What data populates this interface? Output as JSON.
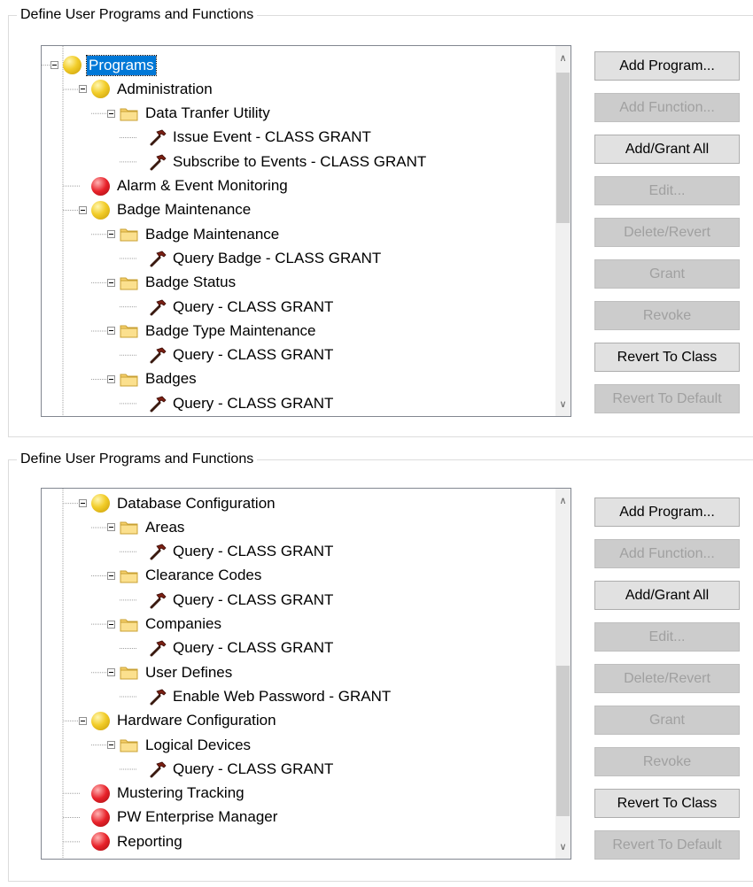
{
  "groups": [
    {
      "legend": "Define User Programs and Functions",
      "tree": [
        {
          "label": "Programs",
          "icon": "ball-yellow",
          "level": 0,
          "selected": true,
          "expander": true
        },
        {
          "label": "Administration",
          "icon": "ball-yellow",
          "level": 1,
          "expander": true
        },
        {
          "label": "Data Tranfer Utility",
          "icon": "folder",
          "level": 2,
          "expander": true
        },
        {
          "label": "Issue Event  -  CLASS GRANT",
          "icon": "hammer",
          "level": 3
        },
        {
          "label": "Subscribe to Events  -  CLASS GRANT",
          "icon": "hammer",
          "level": 3
        },
        {
          "label": "Alarm & Event Monitoring",
          "icon": "ball-red",
          "level": 1
        },
        {
          "label": "Badge Maintenance",
          "icon": "ball-yellow",
          "level": 1,
          "expander": true
        },
        {
          "label": "Badge Maintenance",
          "icon": "folder",
          "level": 2,
          "expander": true
        },
        {
          "label": "Query Badge  -  CLASS GRANT",
          "icon": "hammer",
          "level": 3
        },
        {
          "label": "Badge Status",
          "icon": "folder",
          "level": 2,
          "expander": true
        },
        {
          "label": "Query  -  CLASS GRANT",
          "icon": "hammer",
          "level": 3
        },
        {
          "label": "Badge Type Maintenance",
          "icon": "folder",
          "level": 2,
          "expander": true
        },
        {
          "label": "Query  -  CLASS GRANT",
          "icon": "hammer",
          "level": 3
        },
        {
          "label": "Badges",
          "icon": "folder",
          "level": 2,
          "expander": true
        },
        {
          "label": "Query  -  CLASS GRANT",
          "icon": "hammer",
          "level": 3
        }
      ],
      "scroll_position": 0.0,
      "buttons": [
        {
          "label": "Add Program...",
          "enabled": true
        },
        {
          "label": "Add Function...",
          "enabled": false
        },
        {
          "label": "Add/Grant All",
          "enabled": true
        },
        {
          "label": "Edit...",
          "enabled": false
        },
        {
          "label": "Delete/Revert",
          "enabled": false
        },
        {
          "label": "Grant",
          "enabled": false
        },
        {
          "label": "Revoke",
          "enabled": false
        },
        {
          "label": "Revert To Class",
          "enabled": true
        },
        {
          "label": "Revert To Default",
          "enabled": false
        }
      ]
    },
    {
      "legend": "Define User Programs and Functions",
      "tree": [
        {
          "label": "Database Configuration",
          "icon": "ball-yellow",
          "level": 1,
          "expander": true
        },
        {
          "label": "Areas",
          "icon": "folder",
          "level": 2,
          "expander": true
        },
        {
          "label": "Query  -  CLASS GRANT",
          "icon": "hammer",
          "level": 3
        },
        {
          "label": "Clearance Codes",
          "icon": "folder",
          "level": 2,
          "expander": true
        },
        {
          "label": "Query  -  CLASS GRANT",
          "icon": "hammer",
          "level": 3
        },
        {
          "label": "Companies",
          "icon": "folder",
          "level": 2,
          "expander": true
        },
        {
          "label": "Query  -  CLASS GRANT",
          "icon": "hammer",
          "level": 3
        },
        {
          "label": "User Defines",
          "icon": "folder",
          "level": 2,
          "expander": true
        },
        {
          "label": "Enable Web Password  -  GRANT",
          "icon": "hammer",
          "level": 3
        },
        {
          "label": "Hardware Configuration",
          "icon": "ball-yellow",
          "level": 1,
          "expander": true
        },
        {
          "label": "Logical Devices",
          "icon": "folder",
          "level": 2,
          "expander": true
        },
        {
          "label": "Query  -  CLASS GRANT",
          "icon": "hammer",
          "level": 3
        },
        {
          "label": "Mustering Tracking",
          "icon": "ball-red",
          "level": 1
        },
        {
          "label": "PW Enterprise Manager",
          "icon": "ball-red",
          "level": 1
        },
        {
          "label": "Reporting",
          "icon": "ball-red",
          "level": 1
        }
      ],
      "scroll_position": 1.0,
      "buttons": [
        {
          "label": "Add Program...",
          "enabled": true
        },
        {
          "label": "Add Function...",
          "enabled": false
        },
        {
          "label": "Add/Grant All",
          "enabled": true
        },
        {
          "label": "Edit...",
          "enabled": false
        },
        {
          "label": "Delete/Revert",
          "enabled": false
        },
        {
          "label": "Grant",
          "enabled": false
        },
        {
          "label": "Revoke",
          "enabled": false
        },
        {
          "label": "Revert To Class",
          "enabled": true
        },
        {
          "label": "Revert To Default",
          "enabled": false
        }
      ]
    }
  ]
}
